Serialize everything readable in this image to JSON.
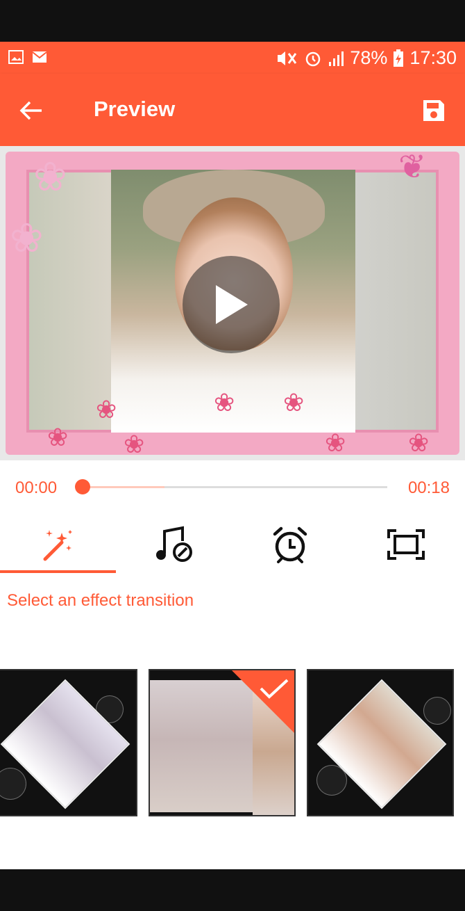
{
  "status_bar": {
    "battery": "78%",
    "time": "17:30",
    "icons": [
      "image-notification-icon",
      "mail-notification-icon",
      "mute-vibrate-icon",
      "alarm-icon",
      "signal-icon",
      "battery-charging-icon"
    ]
  },
  "app_bar": {
    "title": "Preview",
    "back_icon": "arrow-left-icon",
    "save_icon": "save-icon"
  },
  "player": {
    "current_time": "00:00",
    "total_time": "00:18",
    "progress_fraction": 0.0,
    "buffered_fraction": 0.27,
    "play_icon": "play-icon"
  },
  "tabs": [
    {
      "name": "effect",
      "icon": "magic-wand-icon",
      "selected": true
    },
    {
      "name": "music",
      "icon": "music-note-icon",
      "selected": false
    },
    {
      "name": "duration",
      "icon": "alarm-clock-icon",
      "selected": false
    },
    {
      "name": "frame",
      "icon": "frame-icon",
      "selected": false
    }
  ],
  "effect_hint": "Select an effect transition",
  "transitions": [
    {
      "name": "diamond",
      "selected": false
    },
    {
      "name": "cube",
      "selected": true
    },
    {
      "name": "diamond-bokeh",
      "selected": false
    }
  ],
  "colors": {
    "accent": "#ff5a36",
    "frame_pink": "#f3a9c4",
    "divider": "#dddddd"
  }
}
